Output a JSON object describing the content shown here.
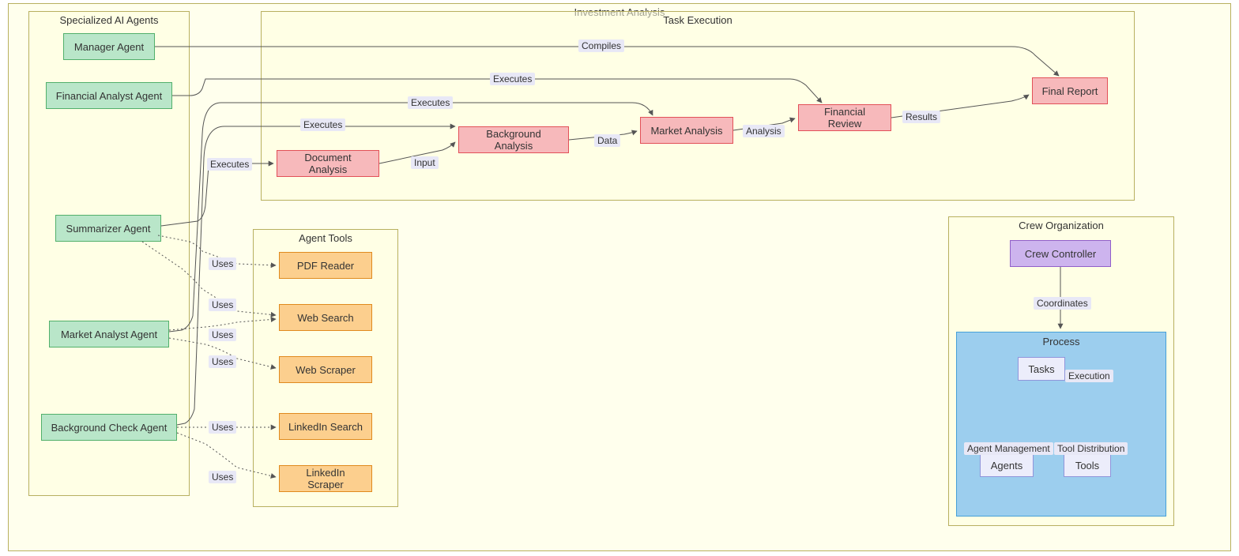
{
  "diagram_title": "Investment Analysis",
  "subgraphs": {
    "agents": "Specialized AI Agents",
    "tasks": "Task Execution",
    "tools": "Agent Tools",
    "crew": "Crew Organization",
    "process": "Process"
  },
  "nodes": {
    "manager": "Manager Agent",
    "financial_analyst": "Financial Analyst Agent",
    "summarizer": "Summarizer Agent",
    "market_analyst": "Market Analyst Agent",
    "background_check": "Background Check Agent",
    "pdf_reader": "PDF Reader",
    "web_search": "Web Search",
    "web_scraper": "Web Scraper",
    "linkedin_search": "LinkedIn Search",
    "linkedin_scraper": "LinkedIn Scraper",
    "document_analysis": "Document Analysis",
    "background_analysis": "Background Analysis",
    "market_analysis": "Market Analysis",
    "financial_review": "Financial Review",
    "final_report": "Final Report",
    "crew_controller": "Crew Controller",
    "tasks_box": "Tasks",
    "agents_box": "Agents",
    "tools_box": "Tools"
  },
  "edge_labels": {
    "compiles": "Compiles",
    "executes": "Executes",
    "uses": "Uses",
    "input": "Input",
    "data": "Data",
    "analysis": "Analysis",
    "results": "Results",
    "coordinates": "Coordinates",
    "execution": "Execution",
    "agent_management": "Agent Management",
    "tool_distribution": "Tool Distribution"
  },
  "chart_data": {
    "type": "graph-diagram",
    "nodes": [
      {
        "id": "manager",
        "label": "Manager Agent",
        "class": "agent"
      },
      {
        "id": "financial_analyst",
        "label": "Financial Analyst Agent",
        "class": "agent"
      },
      {
        "id": "summarizer",
        "label": "Summarizer Agent",
        "class": "agent"
      },
      {
        "id": "market_analyst",
        "label": "Market Analyst Agent",
        "class": "agent"
      },
      {
        "id": "background_check",
        "label": "Background Check Agent",
        "class": "agent"
      },
      {
        "id": "pdf_reader",
        "label": "PDF Reader",
        "class": "tool"
      },
      {
        "id": "web_search",
        "label": "Web Search",
        "class": "tool"
      },
      {
        "id": "web_scraper",
        "label": "Web Scraper",
        "class": "tool"
      },
      {
        "id": "linkedin_search",
        "label": "LinkedIn Search",
        "class": "tool"
      },
      {
        "id": "linkedin_scraper",
        "label": "LinkedIn Scraper",
        "class": "tool"
      },
      {
        "id": "document_analysis",
        "label": "Document Analysis",
        "class": "task"
      },
      {
        "id": "background_analysis",
        "label": "Background Analysis",
        "class": "task"
      },
      {
        "id": "market_analysis",
        "label": "Market Analysis",
        "class": "task"
      },
      {
        "id": "financial_review",
        "label": "Financial Review",
        "class": "task"
      },
      {
        "id": "final_report",
        "label": "Final Report",
        "class": "task"
      },
      {
        "id": "crew_controller",
        "label": "Crew Controller",
        "class": "main"
      },
      {
        "id": "process",
        "label": "Process",
        "class": "process"
      },
      {
        "id": "tasks_box",
        "label": "Tasks",
        "class": "sub"
      },
      {
        "id": "agents_box",
        "label": "Agents",
        "class": "sub"
      },
      {
        "id": "tools_box",
        "label": "Tools",
        "class": "sub"
      }
    ],
    "subgraphs": [
      {
        "id": "investment_analysis",
        "label": "Investment Analysis"
      },
      {
        "id": "specialized_agents",
        "label": "Specialized AI Agents"
      },
      {
        "id": "task_execution",
        "label": "Task Execution"
      },
      {
        "id": "agent_tools",
        "label": "Agent Tools"
      },
      {
        "id": "crew_org",
        "label": "Crew Organization"
      }
    ],
    "edges": [
      {
        "from": "manager",
        "to": "final_report",
        "label": "Compiles",
        "style": "solid"
      },
      {
        "from": "financial_analyst",
        "to": "financial_review",
        "label": "Executes",
        "style": "solid"
      },
      {
        "from": "summarizer",
        "to": "document_analysis",
        "label": "Executes",
        "style": "solid"
      },
      {
        "from": "market_analyst",
        "to": "market_analysis",
        "label": "Executes",
        "style": "solid"
      },
      {
        "from": "background_check",
        "to": "background_analysis",
        "label": "Executes",
        "style": "solid"
      },
      {
        "from": "summarizer",
        "to": "pdf_reader",
        "label": "Uses",
        "style": "dotted"
      },
      {
        "from": "summarizer",
        "to": "web_search",
        "label": "Uses",
        "style": "dotted"
      },
      {
        "from": "market_analyst",
        "to": "web_search",
        "label": "Uses",
        "style": "dotted"
      },
      {
        "from": "market_analyst",
        "to": "web_scraper",
        "label": "Uses",
        "style": "dotted"
      },
      {
        "from": "background_check",
        "to": "linkedin_search",
        "label": "Uses",
        "style": "dotted"
      },
      {
        "from": "background_check",
        "to": "linkedin_scraper",
        "label": "Uses",
        "style": "dotted"
      },
      {
        "from": "document_analysis",
        "to": "background_analysis",
        "label": "Input",
        "style": "solid"
      },
      {
        "from": "background_analysis",
        "to": "market_analysis",
        "label": "Data",
        "style": "solid"
      },
      {
        "from": "market_analysis",
        "to": "financial_review",
        "label": "Analysis",
        "style": "solid"
      },
      {
        "from": "financial_review",
        "to": "final_report",
        "label": "Results",
        "style": "solid"
      },
      {
        "from": "crew_controller",
        "to": "process",
        "label": "Coordinates",
        "style": "solid"
      },
      {
        "from": "process",
        "to": "tasks_box",
        "label": "Execution",
        "style": "solid"
      },
      {
        "from": "process",
        "to": "agents_box",
        "label": "Agent Management",
        "style": "solid"
      },
      {
        "from": "process",
        "to": "tools_box",
        "label": "Tool Distribution",
        "style": "solid"
      }
    ],
    "classes": {
      "agent": {
        "fill": "#b9e6c9",
        "stroke": "#52b06b"
      },
      "tool": {
        "fill": "#fccf8e",
        "stroke": "#e08a1e"
      },
      "task": {
        "fill": "#f7b9bb",
        "stroke": "#e25058"
      },
      "main": {
        "fill": "#cdb4ee",
        "stroke": "#915fc9"
      },
      "process": {
        "fill": "#9cceee",
        "stroke": "#46a0d8"
      },
      "sub": {
        "fill": "#ecedfb",
        "stroke": "#9095db"
      }
    }
  }
}
